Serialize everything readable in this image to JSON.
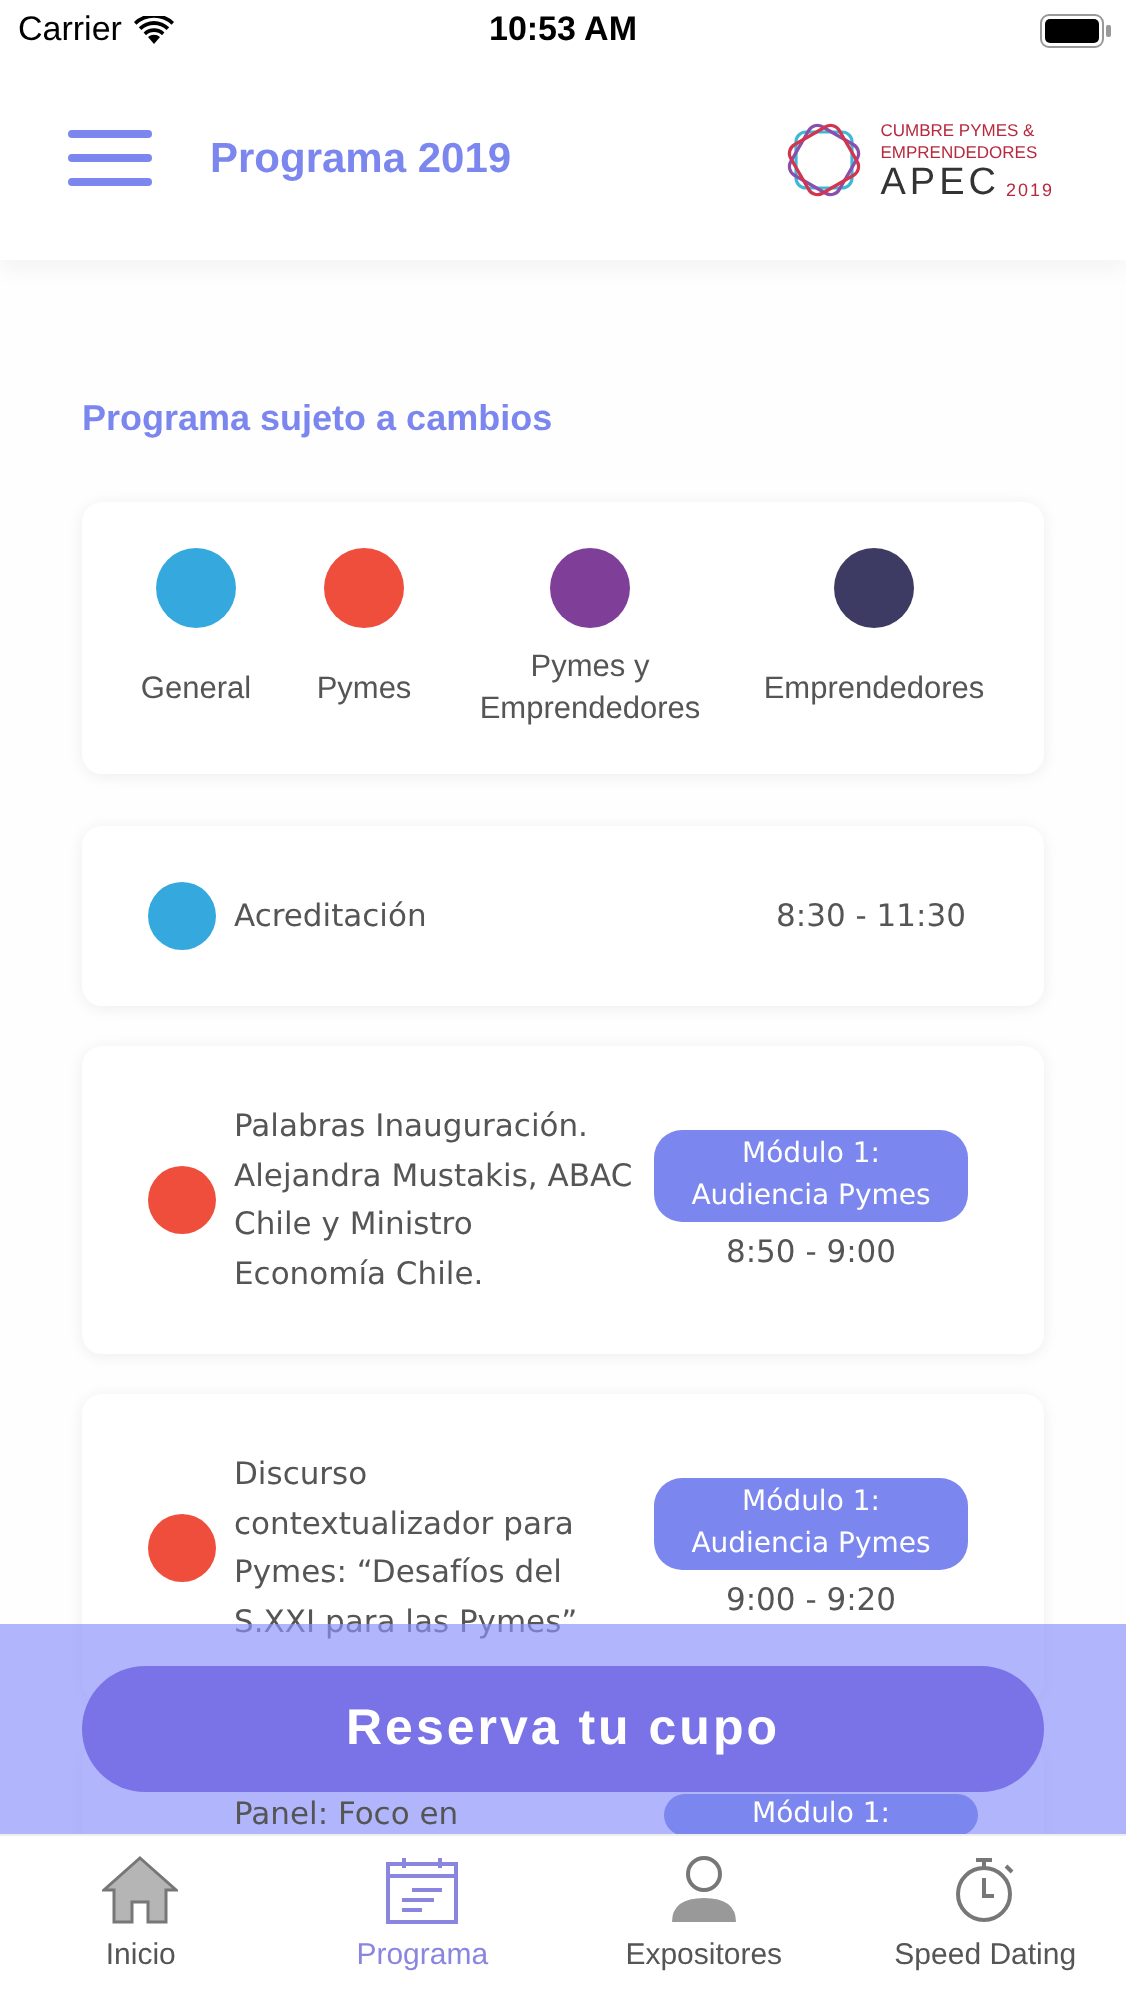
{
  "status_bar": {
    "carrier": "Carrier",
    "time": "10:53 AM"
  },
  "header": {
    "title": "Programa 2019",
    "logo": {
      "line_1": "CUMBRE PYMES &",
      "line_2": "EMPRENDEDORES",
      "brand": "APEC",
      "year": "2019"
    }
  },
  "notice": "Programa sujeto a cambios",
  "legend": [
    {
      "label": "General",
      "color": "#35a8de"
    },
    {
      "label": "Pymes",
      "color": "#ef4e3c"
    },
    {
      "label": "Pymes y Emprendedores",
      "color": "#7f3f98"
    },
    {
      "label": "Emprendedores",
      "color": "#3d3b63"
    }
  ],
  "schedule": [
    {
      "title": "Acreditación",
      "time": "8:30 - 11:30",
      "color": "#35a8de"
    },
    {
      "title": "Palabras Inauguración. Alejandra Mustakis, ABAC Chile y Ministro Economía Chile.",
      "module": "Módulo 1: Audiencia Pymes",
      "time": "8:50 - 9:00",
      "color": "#ef4e3c"
    },
    {
      "title": "Discurso contextualizador para Pymes: “Desafíos del S.XXI para las Pymes”",
      "module": "Módulo 1: Audiencia Pymes",
      "time": "9:00 - 9:20",
      "color": "#ef4e3c"
    },
    {
      "title": "Panel: Foco en",
      "module": "Módulo 1:"
    }
  ],
  "reserve_button": "Reserva tu cupo",
  "tab_bar": [
    {
      "label": "Inicio",
      "kind": "home",
      "selected": false
    },
    {
      "label": "Programa",
      "kind": "calendar",
      "selected": true
    },
    {
      "label": "Expositores",
      "kind": "person",
      "selected": false
    },
    {
      "label": "Speed Dating",
      "kind": "timer",
      "selected": false
    }
  ]
}
